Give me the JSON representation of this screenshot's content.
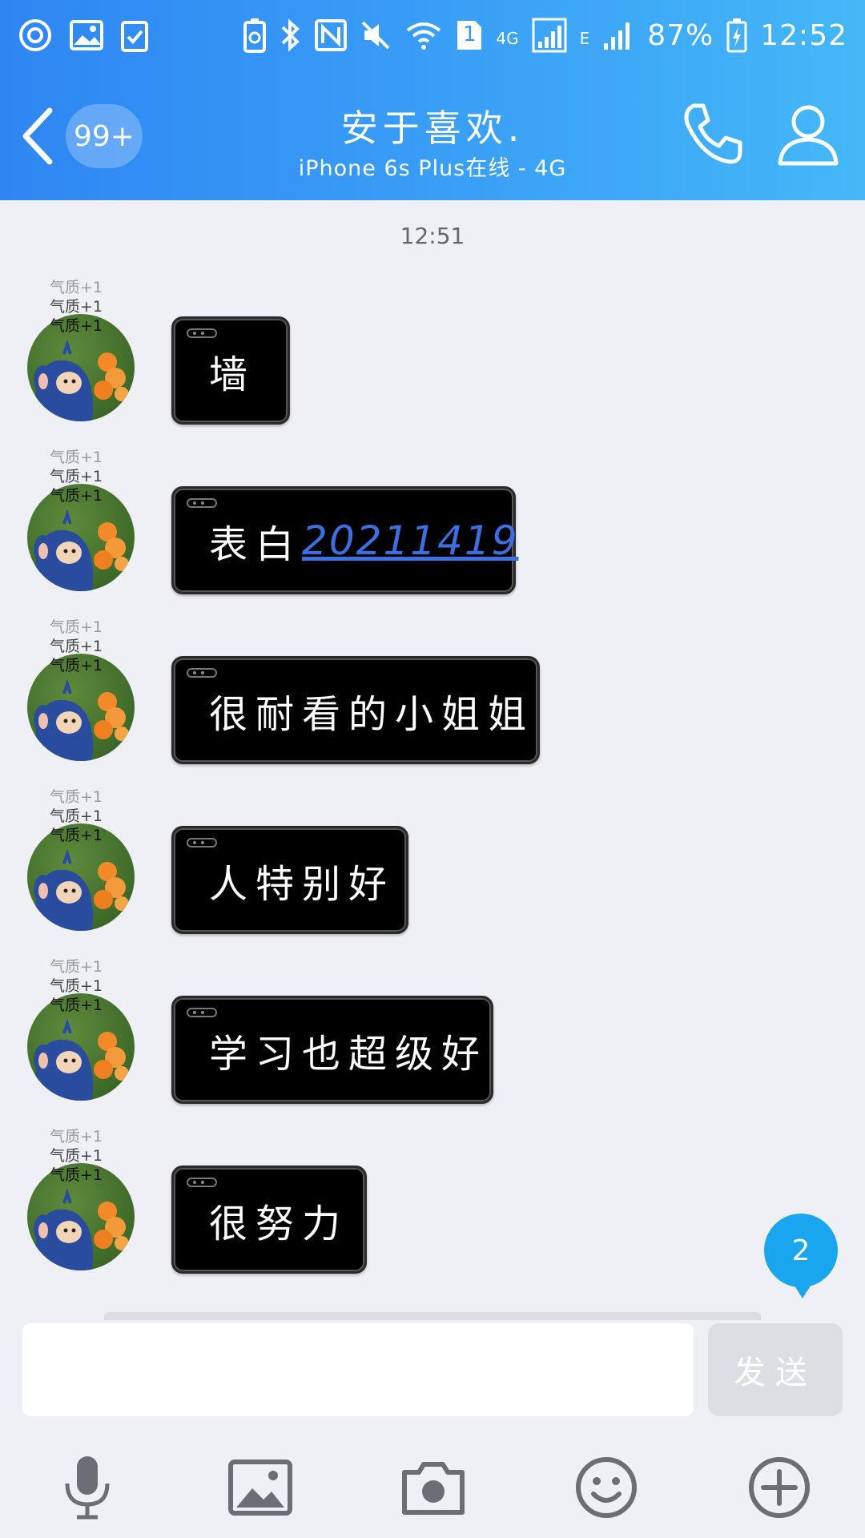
{
  "status_bar": {
    "battery_percent": "87%",
    "time": "12:52",
    "network_4g": "4G",
    "network_e": "E",
    "sim_slot": "1",
    "icons": [
      "app-icon",
      "gallery-icon",
      "clipboard-icon",
      "battery-saver-icon",
      "bluetooth-icon",
      "nfc-icon",
      "mute-icon",
      "wifi-icon",
      "sim-icon",
      "signal-icon",
      "signal-icon",
      "battery-icon"
    ]
  },
  "nav": {
    "unread_count": "99+",
    "contact_name": "安于喜欢.",
    "contact_status": "iPhone 6s Plus在线 - 4G",
    "icons": [
      "back-icon",
      "phone-icon",
      "profile-icon"
    ]
  },
  "chat": {
    "timestamp": "12:51",
    "avatar_tags": [
      "气质+1",
      "气质+1",
      "气质+1"
    ],
    "messages": [
      {
        "text": "墙"
      },
      {
        "text": "表白",
        "link": "20211419"
      },
      {
        "text": "很耐看的小姐姐"
      },
      {
        "text": "人特别好"
      },
      {
        "text": "学习也超级好"
      },
      {
        "text": "很努力"
      }
    ],
    "new_message_count": "2"
  },
  "composer": {
    "input_value": "",
    "send_label": "发送",
    "tools": [
      "microphone-icon",
      "image-icon",
      "camera-icon",
      "emoji-icon",
      "plus-icon"
    ]
  },
  "colors": {
    "header_start": "#2f86f3",
    "header_end": "#45b8f8",
    "background": "#eef0f6",
    "bubble": "#000000",
    "link": "#3c6fe0",
    "badge": "#1aa6ee"
  }
}
